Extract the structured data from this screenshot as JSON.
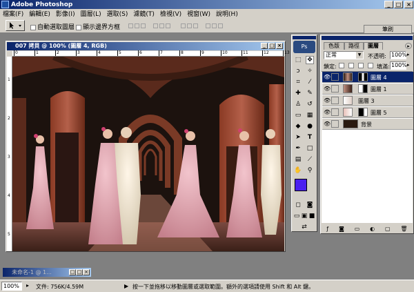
{
  "app": {
    "title": "Adobe Photoshop"
  },
  "menu": [
    "檔案(F)",
    "編輯(E)",
    "影像(I)",
    "圖層(L)",
    "選取(S)",
    "濾鏡(T)",
    "檢視(V)",
    "視窗(W)",
    "說明(H)"
  ],
  "options": {
    "auto_select": "自動選取圖層",
    "show_bounds": "顯示邊界方框",
    "sidebar_tab": "筆刷"
  },
  "document": {
    "title": "007 拷貝 @ 100% (圖層 4, RGB)",
    "ruler_top": [
      "0",
      "1",
      "2",
      "3",
      "4",
      "5",
      "6",
      "7",
      "8",
      "9",
      "10",
      "11",
      "12",
      "13"
    ],
    "ruler_left": [
      "1",
      "2",
      "3",
      "4",
      "5"
    ]
  },
  "layers_panel": {
    "tabs": [
      "色版",
      "路徑",
      "圖層"
    ],
    "blend_mode": "正常",
    "opacity_label": "不透明:",
    "opacity_value": "100%",
    "lock_label": "鎖定:",
    "fill_label": "填滿:",
    "fill_value": "100%",
    "layers": [
      {
        "name": "圖層 4",
        "selected": true
      },
      {
        "name": "圖層 1",
        "selected": false
      },
      {
        "name": "圖層 3",
        "selected": false
      },
      {
        "name": "圖層 5",
        "selected": false
      },
      {
        "name": "背景",
        "selected": false
      }
    ]
  },
  "colors": {
    "foreground": "#4a1ff0",
    "background": "#ffffff",
    "titlebar": "#0a246a"
  },
  "minimized_window": {
    "title": "未命名-1 @ 1..."
  },
  "status": {
    "zoom": "100%",
    "doc_size": "文件: 756K/4.59M",
    "hint": "按一下並拖移以移動圖層或選取範圍。額外的選項請使用 Shift 和 Alt 鍵。"
  }
}
